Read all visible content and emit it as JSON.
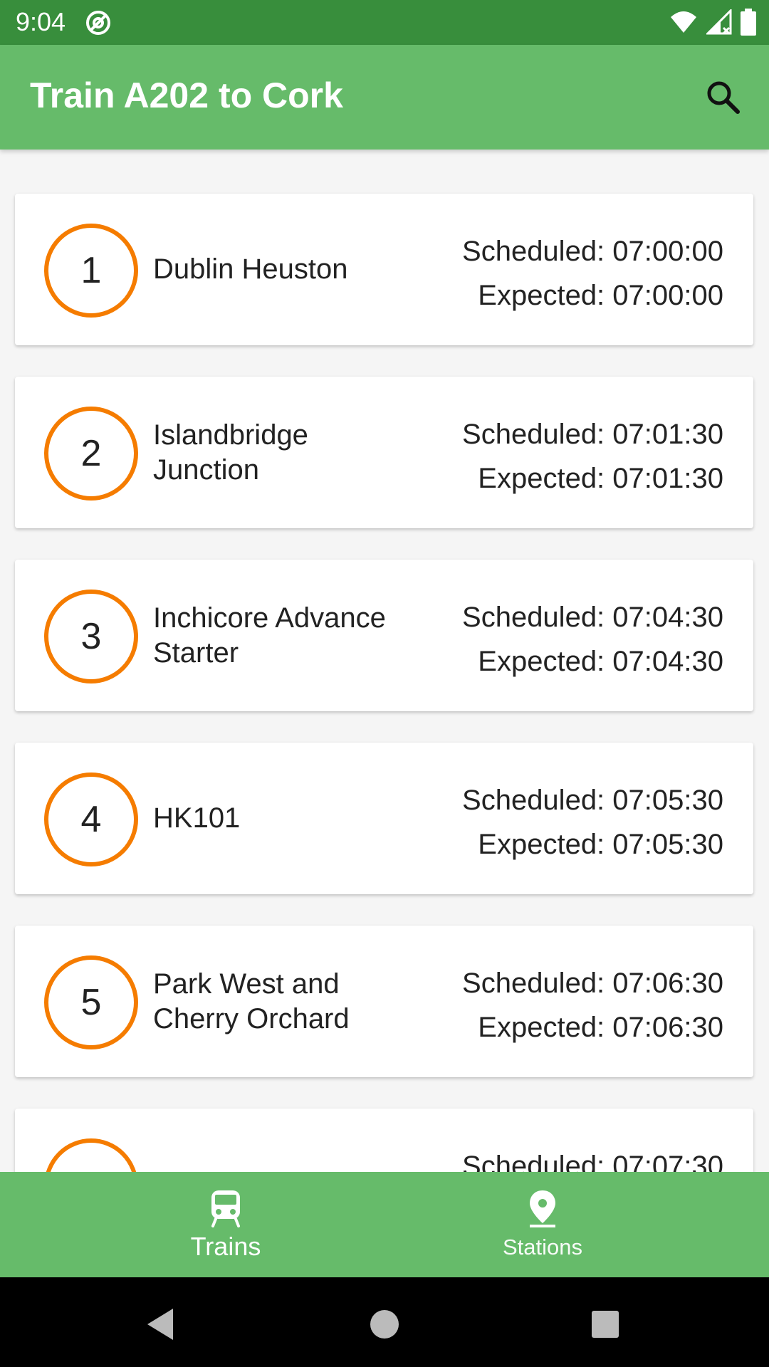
{
  "status_bar": {
    "time": "9:04",
    "icons": [
      "at-sign-icon",
      "wifi-icon",
      "signal-icon",
      "battery-icon"
    ]
  },
  "app_bar": {
    "title": "Train A202 to Cork",
    "search_icon": "search-icon"
  },
  "stops": [
    {
      "number": "1",
      "name": "Dublin Heuston",
      "scheduled": "Scheduled: 07:00:00",
      "expected": "Expected: 07:00:00"
    },
    {
      "number": "2",
      "name": "Islandbridge Junction",
      "scheduled": "Scheduled: 07:01:30",
      "expected": "Expected: 07:01:30"
    },
    {
      "number": "3",
      "name": "Inchicore Advance Starter",
      "scheduled": "Scheduled: 07:04:30",
      "expected": "Expected: 07:04:30"
    },
    {
      "number": "4",
      "name": "HK101",
      "scheduled": "Scheduled: 07:05:30",
      "expected": "Expected: 07:05:30"
    },
    {
      "number": "5",
      "name": "Park West and Cherry Orchard",
      "scheduled": "Scheduled: 07:06:30",
      "expected": "Expected: 07:06:30"
    },
    {
      "number": "",
      "name": "",
      "scheduled": "Scheduled: 07:07:30",
      "expected": ""
    }
  ],
  "bottom_nav": {
    "items": [
      {
        "label": "Trains",
        "icon": "train-icon",
        "selected": true
      },
      {
        "label": "Stations",
        "icon": "map-pin-icon",
        "selected": false
      }
    ]
  },
  "colors": {
    "status_bar": "#388e3c",
    "app_bar": "#66bb6a",
    "accent": "#f57c00",
    "background": "#f5f5f5"
  }
}
